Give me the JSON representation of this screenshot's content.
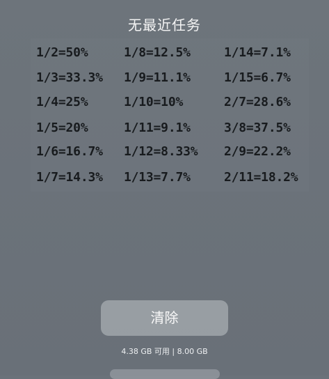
{
  "header": {
    "title": "无最近任务"
  },
  "recent_task_preview": {
    "columns": [
      [
        "1/2=50%",
        "1/3=33.3%",
        "1/4=25%",
        "1/5=20%",
        "1/6=16.7%",
        "1/7=14.3%"
      ],
      [
        "1/8=12.5%",
        "1/9=11.1%",
        "1/10=10%",
        "1/11=9.1%",
        "1/12=8.33%",
        "1/13=7.7%"
      ],
      [
        "1/14=7.1%",
        "1/15=6.7%",
        "2/7=28.6%",
        "3/8=37.5%",
        "2/9=22.2%",
        "2/11=18.2%"
      ]
    ]
  },
  "actions": {
    "clear_label": "清除"
  },
  "memory": {
    "text": "4.38 GB 可用 | 8.00 GB"
  },
  "colors": {
    "background": "#6b727a",
    "button": "#b3b8bd",
    "text": "#f4f4f4",
    "fraction_text": "#181b1e"
  }
}
